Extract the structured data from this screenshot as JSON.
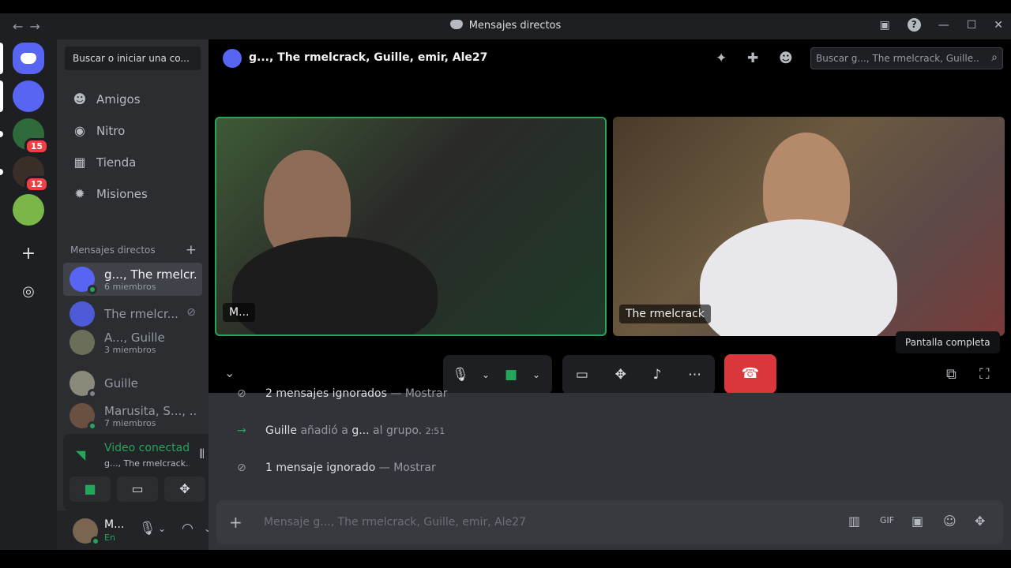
{
  "window": {
    "title": "Mensajes directos"
  },
  "servers": {
    "badge1": "15",
    "badge2": "12"
  },
  "sidebar": {
    "search": "Buscar o iniciar una co...",
    "nav": [
      "Amigos",
      "Nitro",
      "Tienda",
      "Misiones"
    ],
    "dm_header": "Mensajes directos",
    "dms": [
      {
        "name": "g..., The rmelcr...",
        "sub": "6 miembros"
      },
      {
        "name": "The rmelcr...",
        "sub": ""
      },
      {
        "name": "A..., Guille",
        "sub": "3 miembros"
      },
      {
        "name": "Guille",
        "sub": ""
      },
      {
        "name": "Marusita, S..., ...",
        "sub": "7 miembros"
      }
    ]
  },
  "voice": {
    "status": "Video conectado",
    "channel": "g..., The rmelcrack..."
  },
  "user": {
    "name": "M...",
    "status": "En"
  },
  "header": {
    "title": "g..., The rmelcrack, Guille, emir, Ale27",
    "search_placeholder": "Buscar g..., The rmelcrack, Guille..."
  },
  "call": {
    "tile1_label": "M...",
    "tile2_label": "The rmelcrack",
    "tooltip": "Pantalla completa"
  },
  "chat": {
    "m1_text": "2 mensajes ignorados",
    "m1_link": "Mostrar",
    "m2_user": "Guille",
    "m2_mid": "añadió a",
    "m2_target": "g...",
    "m2_end": "al grupo.",
    "m2_time": "2:51",
    "m3_text": "1 mensaje ignorado",
    "m3_link": "Mostrar",
    "composer_placeholder": "Mensaje g..., The rmelcrack, Guille, emir, Ale27"
  }
}
